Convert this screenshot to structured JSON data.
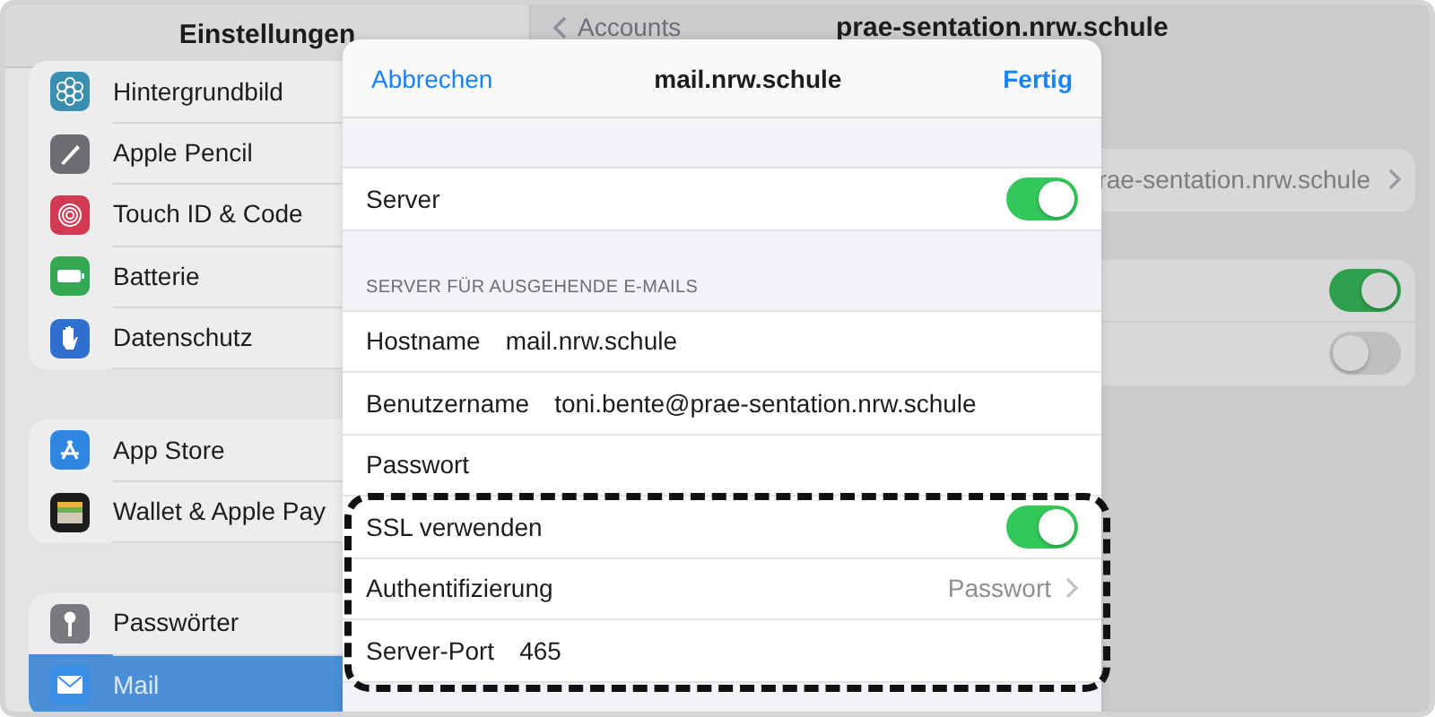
{
  "sidebar": {
    "title": "Einstellungen",
    "groups": [
      {
        "items": [
          {
            "label": "Hintergrundbild",
            "color": "#3a8fb0",
            "selected": false
          },
          {
            "label": "Apple Pencil",
            "color": "#6e6e72",
            "selected": false
          },
          {
            "label": "Touch ID & Code",
            "color": "#d03a52",
            "selected": false
          },
          {
            "label": "Batterie",
            "color": "#34a852",
            "selected": false
          },
          {
            "label": "Datenschutz",
            "color": "#2e6fd0",
            "selected": false
          }
        ]
      },
      {
        "items": [
          {
            "label": "App Store",
            "color": "#2f86e0",
            "selected": false
          },
          {
            "label": "Wallet & Apple Pay",
            "color": "#1c1c1e",
            "selected": false
          }
        ]
      },
      {
        "items": [
          {
            "label": "Passwörter",
            "color": "#7a7a7e",
            "selected": false
          },
          {
            "label": "Mail",
            "color": "#3b8ee8",
            "selected": true
          }
        ]
      }
    ]
  },
  "detail": {
    "back": "Accounts",
    "title": "prae-sentation.nrw.schule",
    "groups": [
      {
        "rows": [
          {
            "kind": "disclosure",
            "value": "rae-sentation.nrw.schule"
          }
        ]
      },
      {
        "rows": [
          {
            "kind": "toggle",
            "on": true
          },
          {
            "kind": "toggle",
            "on": false
          }
        ]
      }
    ]
  },
  "modal": {
    "cancel": "Abbrechen",
    "title": "mail.nrw.schule",
    "done": "Fertig",
    "groups": [
      {
        "rows": [
          {
            "kind": "toggle",
            "label": "Server",
            "on": true
          }
        ]
      },
      {
        "header": "SERVER FÜR AUSGEHENDE E-MAILS",
        "rows": [
          {
            "kind": "field",
            "label": "Hostname",
            "value": "mail.nrw.schule"
          },
          {
            "kind": "field",
            "label": "Benutzername",
            "value": "toni.bente@prae-sentation.nrw.schule"
          },
          {
            "kind": "field",
            "label": "Passwort"
          },
          {
            "kind": "toggle",
            "label": "SSL verwenden",
            "on": true
          },
          {
            "kind": "disclosure",
            "label": "Authentifizierung",
            "value": "Passwort"
          },
          {
            "kind": "field",
            "label": "Server-Port",
            "value": "465"
          }
        ]
      }
    ]
  }
}
